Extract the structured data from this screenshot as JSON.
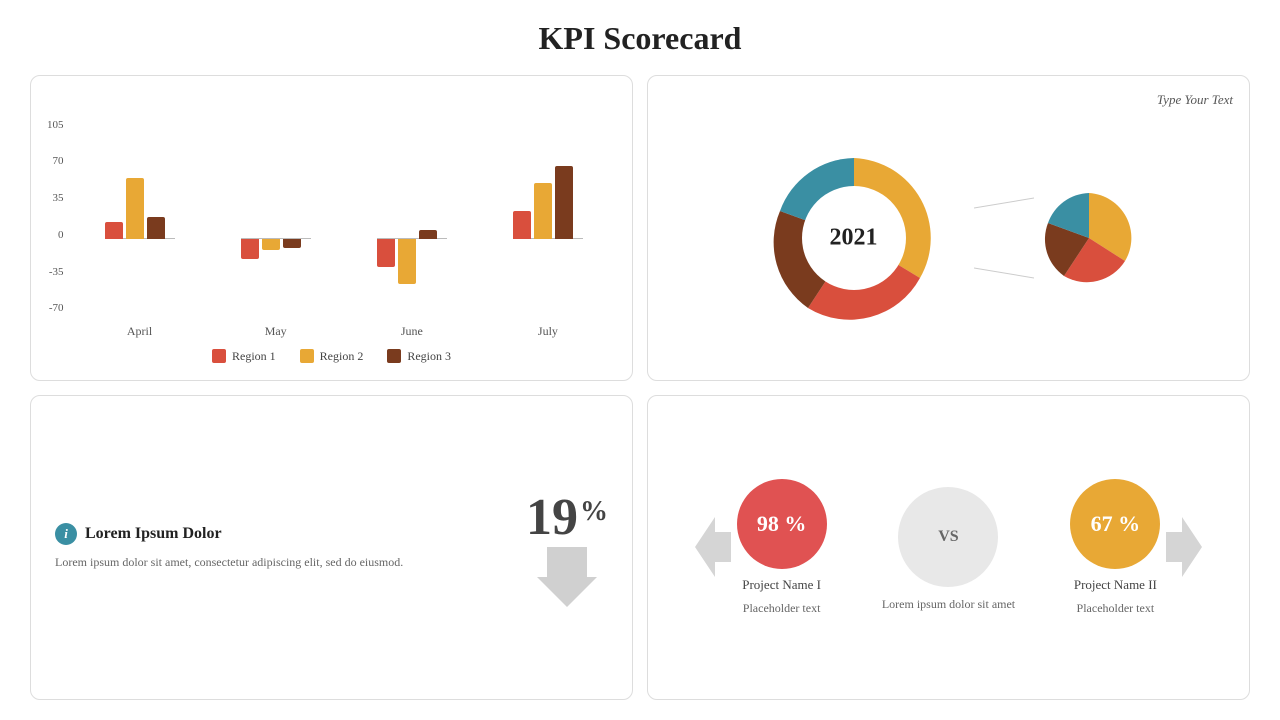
{
  "page": {
    "title": "KPI Scorecard"
  },
  "bar_chart": {
    "y_labels": [
      "105",
      "70",
      "35",
      "0",
      "-35",
      "-70"
    ],
    "legend": [
      {
        "label": "Region 1",
        "color": "#d94f3d"
      },
      {
        "label": "Region 2",
        "color": "#e8a835"
      },
      {
        "label": "Region 3",
        "color": "#7a3b1e"
      }
    ],
    "months": [
      {
        "label": "April",
        "bars": [
          {
            "value": 15,
            "color": "#d94f3d"
          },
          {
            "value": 55,
            "color": "#e8a835"
          },
          {
            "value": 20,
            "color": "#7a3b1e"
          }
        ]
      },
      {
        "label": "May",
        "bars": [
          {
            "value": -18,
            "color": "#d94f3d"
          },
          {
            "value": -10,
            "color": "#e8a835"
          },
          {
            "value": -8,
            "color": "#7a3b1e"
          }
        ]
      },
      {
        "label": "June",
        "bars": [
          {
            "value": -25,
            "color": "#d94f3d"
          },
          {
            "value": -40,
            "color": "#e8a835"
          },
          {
            "value": 8,
            "color": "#7a3b1e"
          }
        ]
      },
      {
        "label": "July",
        "bars": [
          {
            "value": 25,
            "color": "#d94f3d"
          },
          {
            "value": 50,
            "color": "#e8a835"
          },
          {
            "value": 65,
            "color": "#7a3b1e"
          }
        ]
      }
    ]
  },
  "donut_chart": {
    "type_text": "Type Your Text",
    "center_label": "2021",
    "segments": [
      {
        "color": "#e8a835",
        "percent": 32
      },
      {
        "color": "#d94f3d",
        "percent": 28
      },
      {
        "color": "#7a3b1e",
        "percent": 12
      },
      {
        "color": "#3a8fa3",
        "percent": 28
      }
    ]
  },
  "info_card": {
    "title": "Lorem Ipsum Dolor",
    "description": "Lorem ipsum dolor sit amet, consectetur adipiscing elit, sed do eiusmod.",
    "value": "19",
    "percent_sign": "%"
  },
  "comparison": {
    "project1": {
      "score": "98 %",
      "name": "Project Name I",
      "sub": "Placeholder text",
      "color": "red"
    },
    "vs_label": "VS",
    "vs_text": "Lorem ipsum dolor sit amet",
    "project2": {
      "score": "67 %",
      "name": "Project Name II",
      "sub": "Placeholder text",
      "color": "orange"
    }
  }
}
